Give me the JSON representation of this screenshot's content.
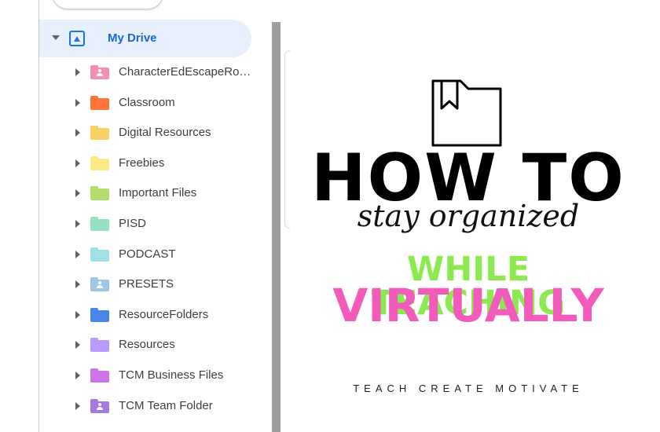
{
  "sidebar": {
    "my_drive_label": "My Drive",
    "folders": [
      {
        "label": "CharacterEdEscapeRo…",
        "color": "#f48fb1",
        "shared": true
      },
      {
        "label": "Classroom",
        "color": "#ff7537",
        "shared": false
      },
      {
        "label": "Digital Resources",
        "color": "#fad165",
        "shared": false
      },
      {
        "label": "Freebies",
        "color": "#fbe983",
        "shared": false
      },
      {
        "label": "Important Files",
        "color": "#b3dc6c",
        "shared": false
      },
      {
        "label": "PISD",
        "color": "#92e1c0",
        "shared": false
      },
      {
        "label": "PODCAST",
        "color": "#9fe1e7",
        "shared": false
      },
      {
        "label": "PRESETS",
        "color": "#9fc6e7",
        "shared": true
      },
      {
        "label": "ResourceFolders",
        "color": "#4986e7",
        "shared": false
      },
      {
        "label": "Resources",
        "color": "#b99aff",
        "shared": false
      },
      {
        "label": "TCM Business Files",
        "color": "#cd74e6",
        "shared": false
      },
      {
        "label": "TCM Team Folder",
        "color": "#a47ae2",
        "shared": true
      }
    ]
  },
  "graphic": {
    "line1": "HOW TO",
    "line2": "stay organized",
    "line3": "WHILE TEACHING",
    "line4": "VIRTUALLY",
    "brand": "TEACH CREATE MOTIVATE",
    "icon": "folder-bookmark-icon"
  },
  "colors": {
    "accent": "#1a73e8",
    "selected_bg": "#e8f0fe",
    "green": "#8ce94f",
    "pink": "#f25bbc"
  }
}
